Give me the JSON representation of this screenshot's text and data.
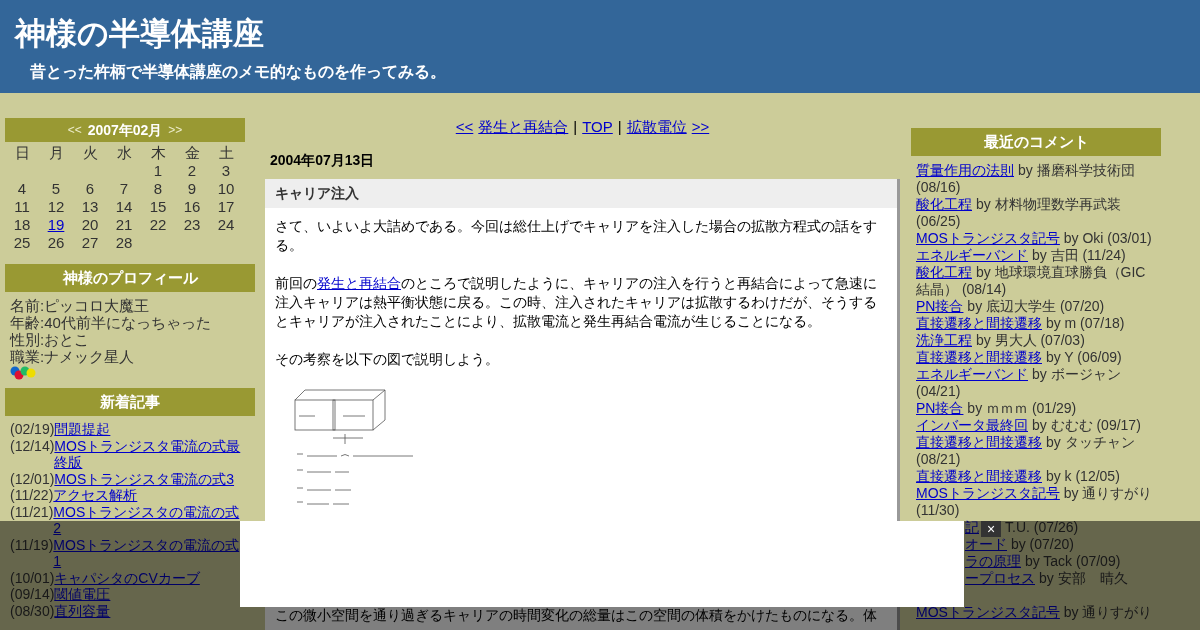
{
  "header": {
    "title": "神様の半導体講座",
    "subtitle": "昔とった杵柄で半導体講座のメモ的なものを作ってみる。"
  },
  "calendar": {
    "prev": "<<",
    "month": "2007年02月",
    "next": ">>",
    "weekdays": [
      "日",
      "月",
      "火",
      "水",
      "木",
      "金",
      "土"
    ],
    "weeks": [
      [
        {
          "kind": "blank"
        },
        {
          "kind": "blank"
        },
        {
          "kind": "blank"
        },
        {
          "kind": "blank"
        },
        {
          "text": "1",
          "kind": "day"
        },
        {
          "text": "2",
          "kind": "day"
        },
        {
          "text": "3",
          "kind": "day"
        }
      ],
      [
        {
          "text": "4",
          "kind": "day"
        },
        {
          "text": "5",
          "kind": "day"
        },
        {
          "text": "6",
          "kind": "day"
        },
        {
          "text": "7",
          "kind": "day"
        },
        {
          "text": "8",
          "kind": "day"
        },
        {
          "text": "9",
          "kind": "day"
        },
        {
          "text": "10",
          "kind": "day"
        }
      ],
      [
        {
          "text": "11",
          "kind": "day"
        },
        {
          "text": "12",
          "kind": "day"
        },
        {
          "text": "13",
          "kind": "day"
        },
        {
          "text": "14",
          "kind": "day"
        },
        {
          "text": "15",
          "kind": "day"
        },
        {
          "text": "16",
          "kind": "day"
        },
        {
          "text": "17",
          "kind": "day"
        }
      ],
      [
        {
          "text": "18",
          "kind": "day"
        },
        {
          "text": "19",
          "kind": "link"
        },
        {
          "text": "20",
          "kind": "day"
        },
        {
          "text": "21",
          "kind": "day"
        },
        {
          "text": "22",
          "kind": "day"
        },
        {
          "text": "23",
          "kind": "day"
        },
        {
          "text": "24",
          "kind": "day"
        }
      ],
      [
        {
          "text": "25",
          "kind": "day"
        },
        {
          "text": "26",
          "kind": "day"
        },
        {
          "text": "27",
          "kind": "day"
        },
        {
          "text": "28",
          "kind": "day"
        }
      ]
    ]
  },
  "profile": {
    "heading": "神様のプロフィール",
    "lines": [
      "名前:ピッコロ大魔王",
      "年齢:40代前半になっちゃった",
      "性別:おとこ",
      "職業:ナメック星人"
    ]
  },
  "recent_posts": {
    "heading": "新着記事",
    "items": [
      {
        "date": "(02/19)",
        "title": "問題提起"
      },
      {
        "date": "(12/14)",
        "title": "MOSトランジスタ電流の式最終版"
      },
      {
        "date": "(12/01)",
        "title": "MOSトランジスタ電流の式3"
      },
      {
        "date": "(11/22)",
        "title": "アクセス解析"
      },
      {
        "date": "(11/21)",
        "title": "MOSトランジスタの電流の式2"
      },
      {
        "date": "(11/19)",
        "title": "MOSトランジスタの電流の式1"
      },
      {
        "date": "(10/01)",
        "title": "キャパシタのCVカーブ"
      },
      {
        "date": "(09/14)",
        "title": "閾値電圧"
      },
      {
        "date": "(08/30)",
        "title": "直列容量"
      }
    ]
  },
  "nav": [
    {
      "text": "<<",
      "kind": "link"
    },
    {
      "text": "発生と再結合",
      "kind": "link"
    },
    {
      "text": "|",
      "kind": "separator"
    },
    {
      "text": "TOP",
      "kind": "link"
    },
    {
      "text": "|",
      "kind": "separator"
    },
    {
      "text": "拡散電位",
      "kind": "link"
    },
    {
      "text": ">>",
      "kind": "link"
    }
  ],
  "article": {
    "date": "2004年07月13日",
    "title": "キャリア注入",
    "paragraphs": [
      [
        {
          "text": "さて、いよいよ大詰めである。今回は総仕上げでキャリアを注入した場合の拡散方程式の話をする。",
          "kind": "text"
        }
      ],
      [
        {
          "text": "前回の",
          "kind": "text"
        },
        {
          "text": "発生と再結合",
          "kind": "link"
        },
        {
          "text": "のところで説明したように、キャリアの注入を行うと再結合によって急速に注入キャリアは熱平衡状態に戻る。この時、注入されたキャリアは拡散するわけだが、そうするとキャリアが注入されたことにより、拡散電流と発生再結合電流が生じることになる。",
          "kind": "text"
        }
      ],
      [
        {
          "text": "その考察を以下の図で説明しよう。",
          "kind": "text"
        }
      ]
    ],
    "after_figure": "この微小空間を通り過ぎるキャリアの時間変化の総量はこの空間の体積をかけたものになる。体"
  },
  "recent_comments": {
    "heading": "最近のコメント",
    "items": [
      {
        "kind": "full",
        "title": "質量作用の法則",
        "by": " by 播磨科学技術団 (08/16)"
      },
      {
        "kind": "full",
        "title": "酸化工程",
        "by": " by 材料物理数学再武装 (06/25)"
      },
      {
        "kind": "full",
        "title": "MOSトランジスタ記号",
        "by": " by Oki (03/01)"
      },
      {
        "kind": "full",
        "title": "エネルギーバンド",
        "by": " by 吉田 (11/24)"
      },
      {
        "kind": "full",
        "title": "酸化工程",
        "by": " by 地球環境直球勝負（GIC結晶） (08/14)"
      },
      {
        "kind": "full",
        "title": "PN接合",
        "by": " by 底辺大学生 (07/20)"
      },
      {
        "kind": "full",
        "title": "直接遷移と間接遷移",
        "by": " by m (07/18)"
      },
      {
        "kind": "full",
        "title": "洗浄工程",
        "by": " by 男大人 (07/03)"
      },
      {
        "kind": "full",
        "title": "直接遷移と間接遷移",
        "by": " by Y (06/09)"
      },
      {
        "kind": "full",
        "title": "エネルギーバンド",
        "by": " by ボージャン (04/21)"
      },
      {
        "kind": "full",
        "title": "PN接合",
        "by": " by ｍｍｍ (01/29)"
      },
      {
        "kind": "full",
        "title": "インバータ最終回",
        "by": " by むむむ (09/17)"
      },
      {
        "kind": "full",
        "title": "直接遷移と間接遷移",
        "by": " by タッチャン (08/21)"
      },
      {
        "kind": "full",
        "title": "直接遷移と間接遷移",
        "by": " by k (12/05)"
      },
      {
        "kind": "full",
        "title": "MOSトランジスタ記号",
        "by": " by 通りすがり (11/30)"
      },
      {
        "kind": "partial",
        "title": "記",
        "by": "T.U. (07/26)"
      },
      {
        "kind": "partial",
        "title": "オード",
        "by": " by (07/20)"
      },
      {
        "kind": "partial",
        "title": "ラの原理",
        "by": " by Tack (07/09)"
      },
      {
        "kind": "partial_wrapped",
        "title": "ープロセス",
        "by": " by 安部　晴久"
      },
      {
        "kind": "full",
        "title": "MOSトランジスタ記号",
        "by": " by 通りすがり"
      }
    ]
  },
  "ad_overlay": {
    "close": "×"
  }
}
